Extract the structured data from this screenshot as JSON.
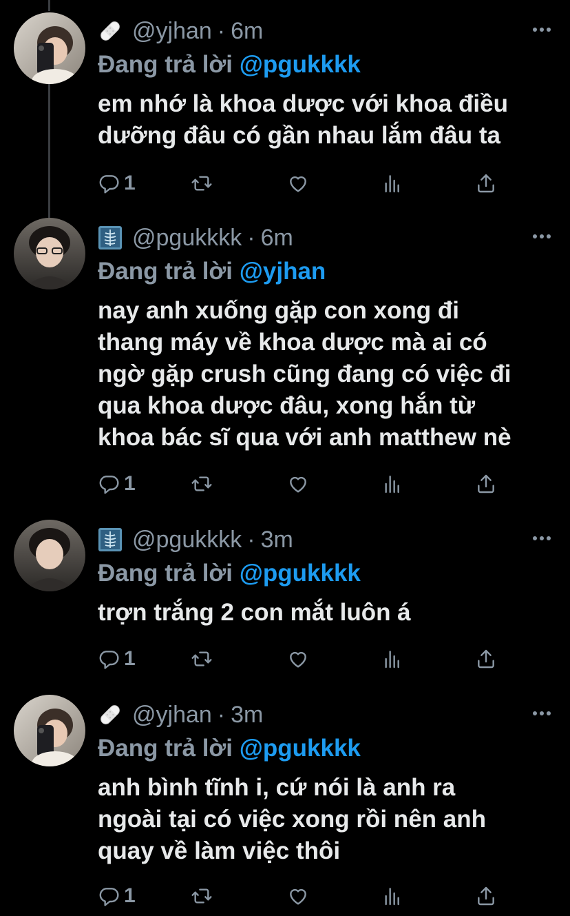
{
  "tweets": [
    {
      "handle": "@yjhan",
      "time": "6m",
      "emoji": "bandage",
      "reply_label": "Đang trả lời",
      "reply_to": "@pgukkkk",
      "text": "em nhớ là khoa dược với khoa điều\ndưỡng đâu có gần nhau lắm đâu ta",
      "reply_count": "1"
    },
    {
      "handle": "@pgukkkk",
      "time": "6m",
      "emoji": "x-ray",
      "reply_label": "Đang trả lời",
      "reply_to": "@yjhan",
      "text": "nay anh xuống gặp con xong đi\nthang máy về khoa dược mà ai có\nngờ gặp crush cũng đang có việc đi\nqua khoa dược đâu, xong hắn từ\nkhoa bác sĩ qua với anh matthew nè",
      "reply_count": "1"
    },
    {
      "handle": "@pgukkkk",
      "time": "3m",
      "emoji": "x-ray",
      "reply_label": "Đang trả lời",
      "reply_to": "@pgukkkk",
      "text": "trợn trắng 2 con mắt luôn á",
      "reply_count": "1"
    },
    {
      "handle": "@yjhan",
      "time": "3m",
      "emoji": "bandage",
      "reply_label": "Đang trả lời",
      "reply_to": "@pgukkkk",
      "text": "anh bình tĩnh i, cứ nói là anh ra\nngoài tại có việc xong rồi nên anh\nquay về làm việc thôi",
      "reply_count": "1"
    }
  ],
  "colors": {
    "background": "#000000",
    "text": "#e7e9ea",
    "muted": "#8b98a5",
    "accent": "#1d9bf0",
    "thread_line": "#3a3d41"
  },
  "icons": [
    "reply-icon",
    "retweet-icon",
    "like-icon",
    "analytics-icon",
    "share-icon",
    "more-icon"
  ]
}
